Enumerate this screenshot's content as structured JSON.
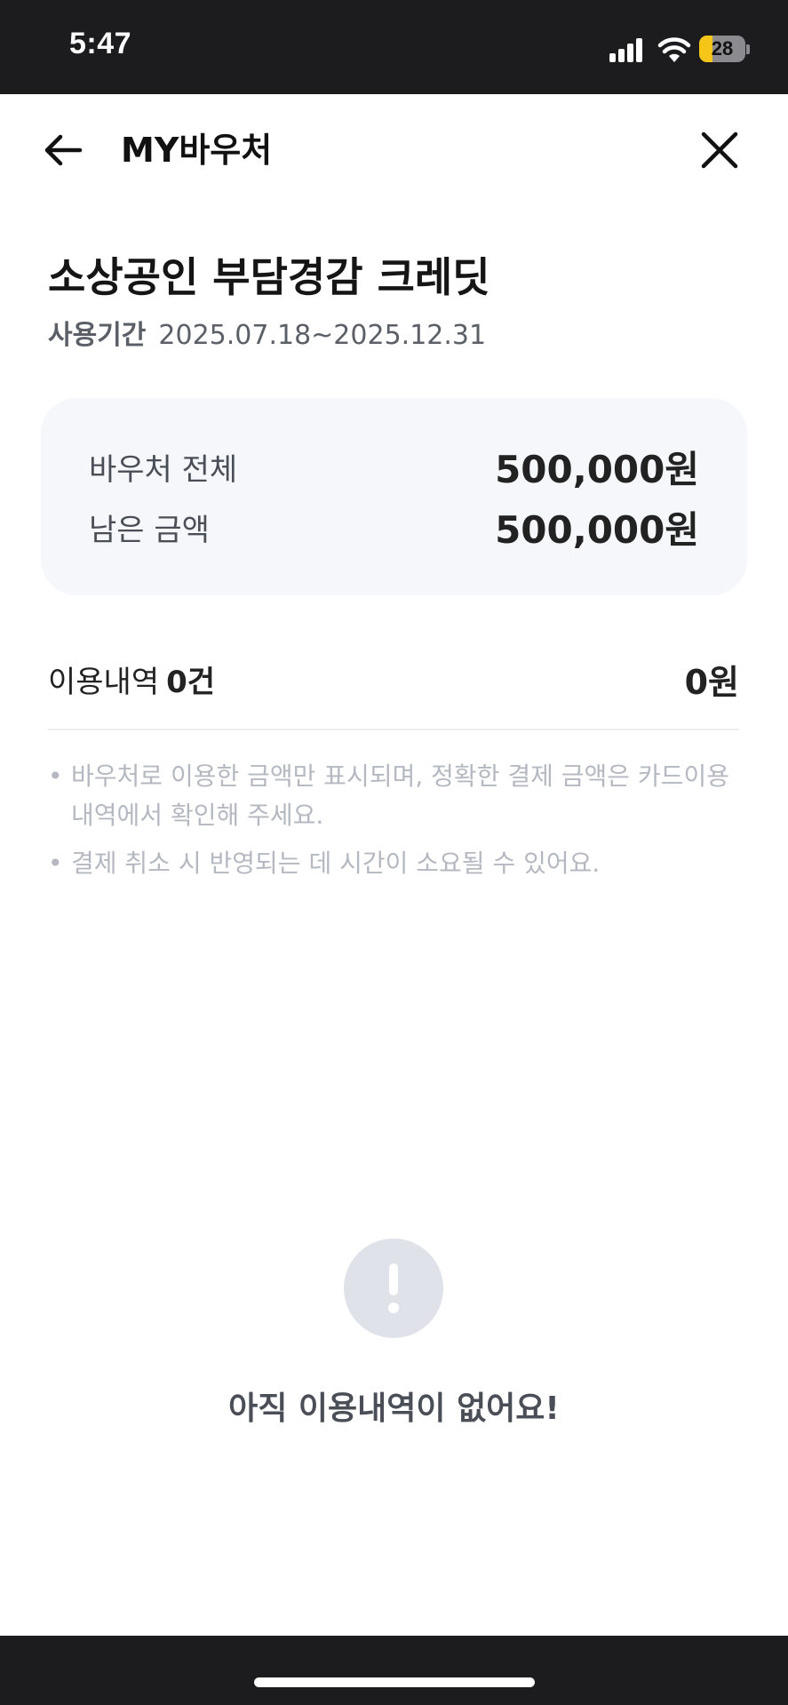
{
  "status_bar": {
    "time": "5:47",
    "battery_level": "28",
    "battery_fraction": 0.28,
    "signal_icon": "cellular-signal-icon",
    "wifi_icon": "wifi-icon",
    "battery_color": "#f5c518"
  },
  "header": {
    "title": "MY바우처",
    "back_icon": "arrow-left-icon",
    "close_icon": "close-icon"
  },
  "voucher": {
    "title": "소상공인 부담경감 크레딧",
    "period_label": "사용기간",
    "period_value": "2025.07.18~2025.12.31"
  },
  "summary": {
    "rows": [
      {
        "label": "바우처 전체",
        "value": "500,000원"
      },
      {
        "label": "남은 금액",
        "value": "500,000원"
      }
    ]
  },
  "usage": {
    "label": "이용내역",
    "count": "0건",
    "amount": "0원"
  },
  "notes": [
    "바우처로 이용한 금액만 표시되며, 정확한 결제 금액은 카드이용내역에서 확인해 주세요.",
    "결제 취소 시 반영되는 데 시간이 소요될 수 있어요."
  ],
  "empty_state": {
    "icon": "exclamation-circle-icon",
    "message": "아직 이용내역이 없어요!"
  },
  "colors": {
    "status_bar_bg": "#1c1c1f",
    "card_bg": "#f6f7fb",
    "note_text": "#b4b9c1",
    "empty_icon_bg": "#dfe2e9"
  }
}
